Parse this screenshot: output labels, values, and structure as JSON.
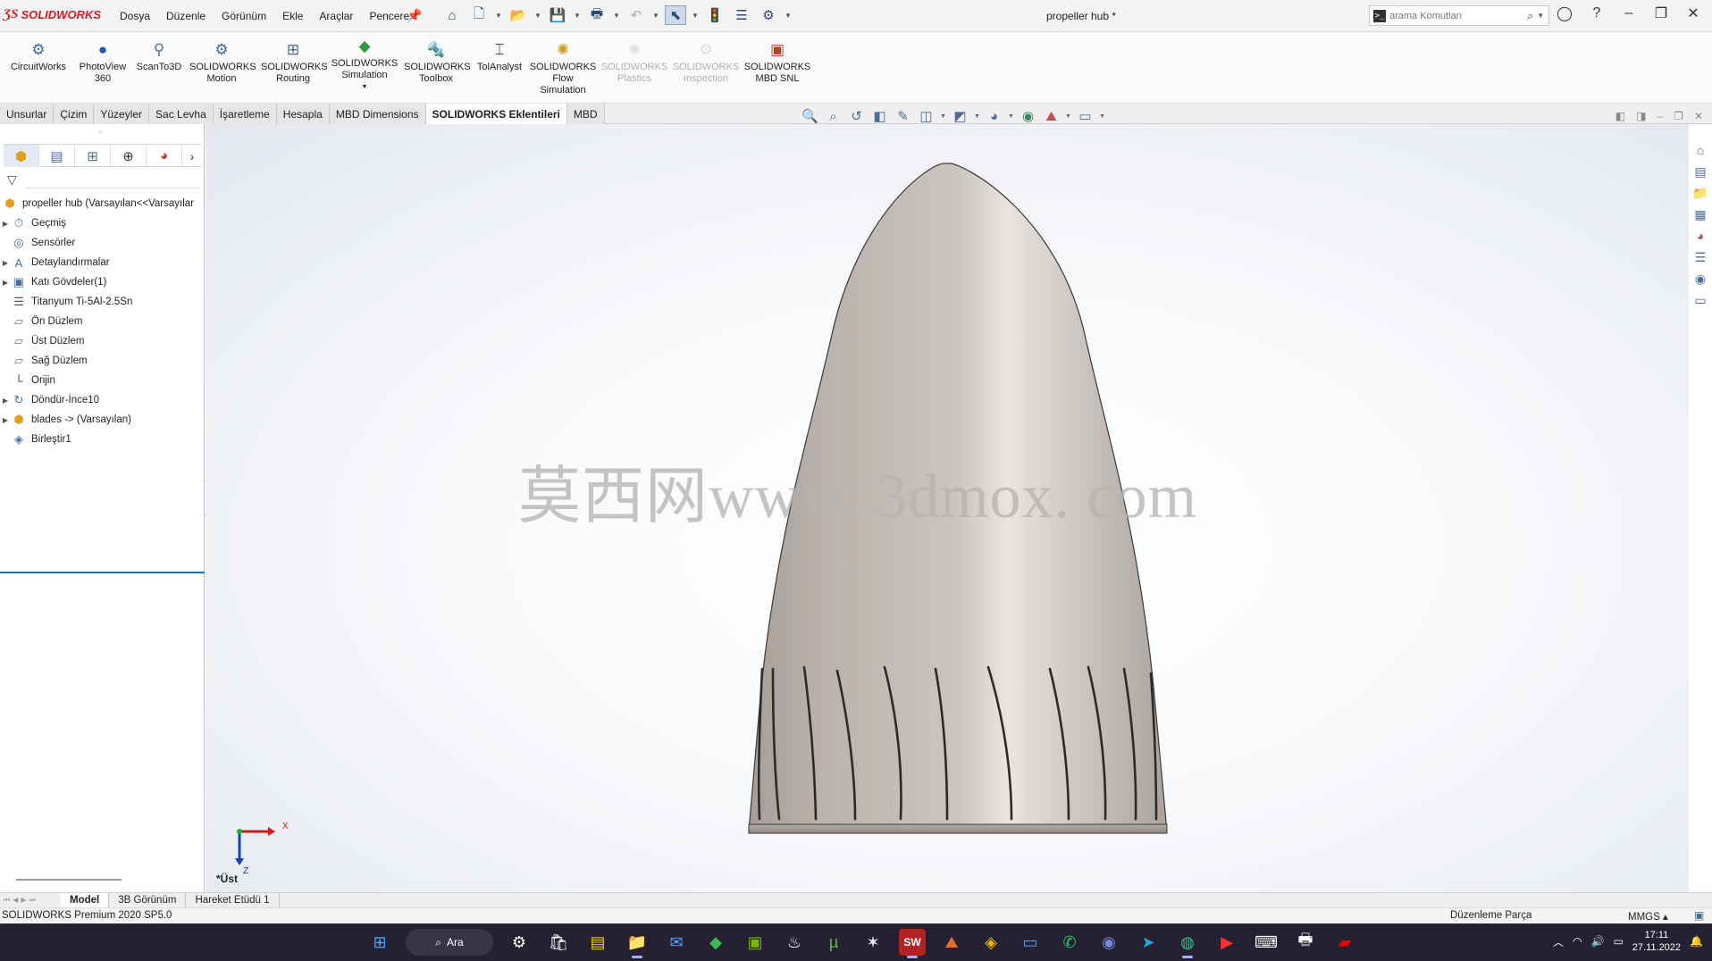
{
  "app": {
    "brand": "SOLIDWORKS",
    "document_title": "propeller hub *"
  },
  "menu": [
    "Dosya",
    "Düzenle",
    "Görünüm",
    "Ekle",
    "Araçlar",
    "Pencere"
  ],
  "search": {
    "placeholder": "arama Komutları"
  },
  "ribbon": [
    {
      "label": "CircuitWorks",
      "icon": "circuitworks-icon",
      "enabled": true
    },
    {
      "label": "PhotoView 360",
      "icon": "photoview-icon",
      "enabled": true
    },
    {
      "label": "ScanTo3D",
      "icon": "scanto3d-icon",
      "enabled": true
    },
    {
      "label": "SOLIDWORKS Motion",
      "icon": "motion-icon",
      "enabled": true
    },
    {
      "label": "SOLIDWORKS Routing",
      "icon": "routing-icon",
      "enabled": true
    },
    {
      "label": "SOLIDWORKS Simulation",
      "icon": "simulation-icon",
      "enabled": true
    },
    {
      "label": "SOLIDWORKS Toolbox",
      "icon": "toolbox-icon",
      "enabled": true
    },
    {
      "label": "TolAnalyst",
      "icon": "tolanalyst-icon",
      "enabled": true
    },
    {
      "label": "SOLIDWORKS Flow Simulation",
      "icon": "flow-simulation-icon",
      "enabled": true
    },
    {
      "label": "SOLIDWORKS Plastics",
      "icon": "plastics-icon",
      "enabled": false
    },
    {
      "label": "SOLIDWORKS Inspection",
      "icon": "inspection-icon",
      "enabled": false
    },
    {
      "label": "SOLIDWORKS MBD SNL",
      "icon": "mbd-snl-icon",
      "enabled": true
    }
  ],
  "tabs": [
    "Unsurlar",
    "Çizim",
    "Yüzeyler",
    "Sac Levha",
    "İşaretleme",
    "Hesapla",
    "MBD Dimensions",
    "SOLIDWORKS Eklentileri",
    "MBD"
  ],
  "active_tab": "SOLIDWORKS Eklentileri",
  "feature_tree": {
    "root": "propeller hub  (Varsayılan<<Varsayılar",
    "items": [
      {
        "label": "Geçmiş",
        "icon": "history-icon",
        "expandable": true
      },
      {
        "label": "Sensörler",
        "icon": "sensor-icon",
        "expandable": false
      },
      {
        "label": "Detaylandırmalar",
        "icon": "annotations-icon",
        "expandable": true
      },
      {
        "label": "Katı Gövdeler(1)",
        "icon": "solid-bodies-icon",
        "expandable": true
      },
      {
        "label": "Titanyum Ti-5Al-2.5Sn",
        "icon": "material-icon",
        "expandable": false
      },
      {
        "label": "Ön Düzlem",
        "icon": "plane-icon",
        "expandable": false
      },
      {
        "label": "Üst Düzlem",
        "icon": "plane-icon",
        "expandable": false
      },
      {
        "label": "Sağ Düzlem",
        "icon": "plane-icon",
        "expandable": false
      },
      {
        "label": "Orijin",
        "icon": "origin-icon",
        "expandable": false
      },
      {
        "label": "Döndür-İnce10",
        "icon": "revolve-thin-icon",
        "expandable": true
      },
      {
        "label": "blades -> (Varsayılan)",
        "icon": "part-reference-icon",
        "expandable": true
      },
      {
        "label": "Birleştir1",
        "icon": "combine-icon",
        "expandable": false
      }
    ]
  },
  "viewport": {
    "watermark": "莫西网www. 3dmox. com",
    "view_name": "*Üst",
    "triad": {
      "x": "X",
      "z": "Z"
    }
  },
  "bottom_tabs": [
    "Model",
    "3B Görünüm",
    "Hareket Etüdü 1"
  ],
  "status": {
    "version": "SOLIDWORKS Premium 2020 SP5.0",
    "mode": "Düzenleme Parça",
    "units": "MMGS"
  },
  "taskbar": {
    "search_label": "Ara",
    "time": "17:11",
    "date": "27.11.2022"
  },
  "colors": {
    "brand_red": "#d21f26",
    "taskbar": "#262033",
    "model_body": "#c2bab5"
  }
}
